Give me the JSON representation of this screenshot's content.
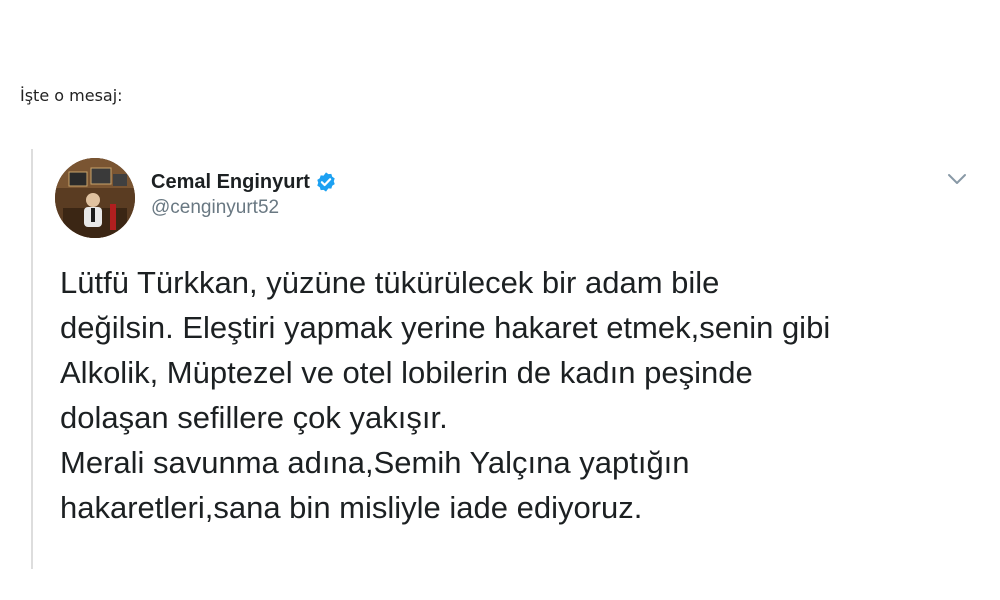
{
  "intro_text": "İşte o mesaj:",
  "tweet": {
    "display_name": "Cemal Enginyurt",
    "handle": "@cenginyurt52",
    "verified": true,
    "icons": {
      "verified": "verified-badge-icon",
      "menu": "chevron-down-icon"
    },
    "accent_color": "#1da1f2",
    "lines": [
      "Lütfü Türkkan, yüzüne tükürülecek bir adam bile",
      "değilsin. Eleştiri yapmak yerine hakaret etmek,senin gibi",
      "Alkolik, Müptezel ve otel lobilerin de kadın peşinde",
      "dolaşan sefillere çok yakışır.",
      "Merali savunma adına,Semih Yalçına yaptığın",
      "hakaretleri,sana bin misliyle iade ediyoruz."
    ]
  }
}
